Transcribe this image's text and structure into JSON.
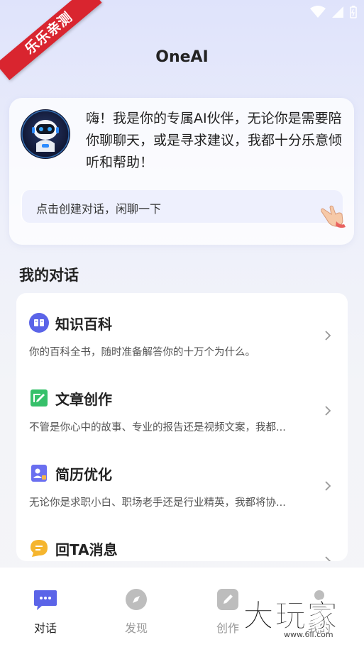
{
  "status_bar": {
    "wifi_icon": "wifi-icon",
    "signal_icon": "signal-icon",
    "battery_icon": "battery-icon"
  },
  "ribbon": {
    "text": "乐乐亲测"
  },
  "header": {
    "title": "OneAI"
  },
  "welcome": {
    "message": "嗨！我是你的专属AI伙伴，无论你是需要陪你聊聊天，或是寻求建议，我都十分乐意倾听和帮助！",
    "input_prompt": "点击创建对话，闲聊一下"
  },
  "section": {
    "title": "我的对话"
  },
  "conversations": [
    {
      "icon": "book-icon",
      "title": "知识百科",
      "desc": "你的百科全书，随时准备解答你的十万个为什么。"
    },
    {
      "icon": "edit-icon",
      "title": "文章创作",
      "desc": "不管是你心中的故事、专业的报告还是视频文案，我都..."
    },
    {
      "icon": "resume-icon",
      "title": "简历优化",
      "desc": "无论你是求职小白、职场老手还是行业精英，我都将协..."
    },
    {
      "icon": "message-icon",
      "title": "回TA消息",
      "desc": ""
    }
  ],
  "nav": [
    {
      "label": "对话",
      "icon": "chat-icon",
      "active": true
    },
    {
      "label": "发现",
      "icon": "compass-icon",
      "active": false
    },
    {
      "label": "创作",
      "icon": "pen-icon",
      "active": false
    },
    {
      "label": "我的",
      "icon": "user-icon",
      "active": false
    }
  ],
  "watermark": {
    "big": "大玩家",
    "small": "www.6ll.com"
  },
  "colors": {
    "accent": "#5b64e8",
    "ribbon": "#d9252f"
  }
}
